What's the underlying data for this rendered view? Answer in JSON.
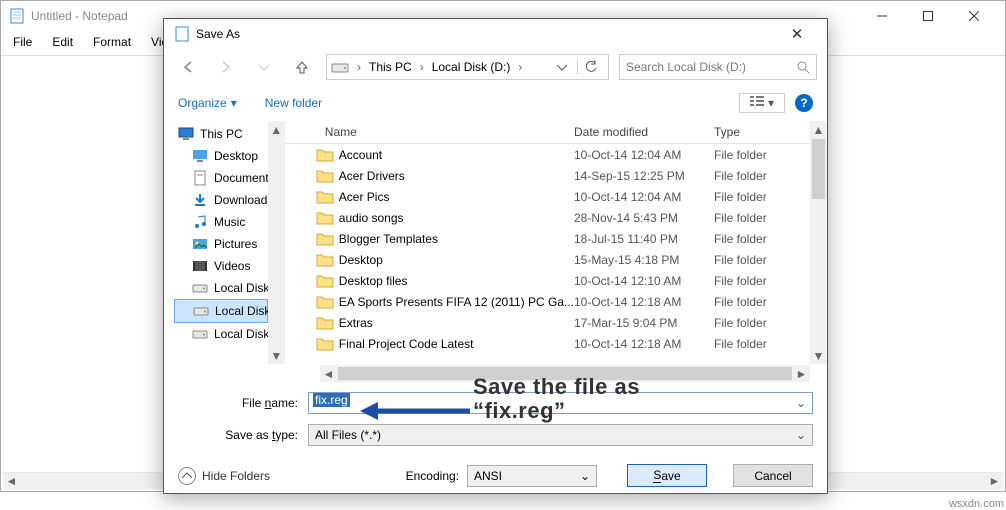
{
  "notepad": {
    "title": "Untitled - Notepad",
    "menu": [
      "File",
      "Edit",
      "Format",
      "View"
    ]
  },
  "dialog": {
    "title": "Save As",
    "nav": {
      "crumb1": "This PC",
      "crumb2": "Local Disk (D:)"
    },
    "search_placeholder": "Search Local Disk (D:)",
    "toolbar": {
      "organize": "Organize",
      "newfolder": "New folder"
    },
    "tree": [
      {
        "icon": "monitor",
        "label": "This PC"
      },
      {
        "icon": "desktop",
        "label": "Desktop"
      },
      {
        "icon": "doc",
        "label": "Documents"
      },
      {
        "icon": "download",
        "label": "Downloads"
      },
      {
        "icon": "music",
        "label": "Music"
      },
      {
        "icon": "pictures",
        "label": "Pictures"
      },
      {
        "icon": "video",
        "label": "Videos"
      },
      {
        "icon": "drive",
        "label": "Local Disk (C:)"
      },
      {
        "icon": "drive",
        "label": "Local Disk (D:)",
        "selected": true
      },
      {
        "icon": "drive",
        "label": "Local Disk (E:)"
      }
    ],
    "columns": {
      "name": "Name",
      "date": "Date modified",
      "type": "Type"
    },
    "rows": [
      {
        "name": "Account",
        "date": "10-Oct-14 12:04 AM",
        "type": "File folder"
      },
      {
        "name": "Acer Drivers",
        "date": "14-Sep-15 12:25 PM",
        "type": "File folder"
      },
      {
        "name": "Acer Pics",
        "date": "10-Oct-14 12:04 AM",
        "type": "File folder"
      },
      {
        "name": "audio songs",
        "date": "28-Nov-14 5:43 PM",
        "type": "File folder"
      },
      {
        "name": "Blogger Templates",
        "date": "18-Jul-15 11:40 PM",
        "type": "File folder"
      },
      {
        "name": "Desktop",
        "date": "15-May-15 4:18 PM",
        "type": "File folder"
      },
      {
        "name": "Desktop files",
        "date": "10-Oct-14 12:10 AM",
        "type": "File folder"
      },
      {
        "name": "EA Sports Presents FIFA 12 (2011) PC Ga...",
        "date": "10-Oct-14 12:18 AM",
        "type": "File folder"
      },
      {
        "name": "Extras",
        "date": "17-Mar-15 9:04 PM",
        "type": "File folder"
      },
      {
        "name": "Final Project Code Latest",
        "date": "10-Oct-14 12:18 AM",
        "type": "File folder"
      }
    ],
    "filename_label": "File name:",
    "filename_value": "fix.reg",
    "savetype_label": "Save as type:",
    "savetype_value": "All Files  (*.*)",
    "hide": "Hide Folders",
    "encoding_label": "Encoding:",
    "encoding_value": "ANSI",
    "save": "Save",
    "cancel": "Cancel"
  },
  "annotation": {
    "line1": "Save the file as",
    "line2": "“fix.reg”"
  },
  "watermark": "wsxdn.com"
}
